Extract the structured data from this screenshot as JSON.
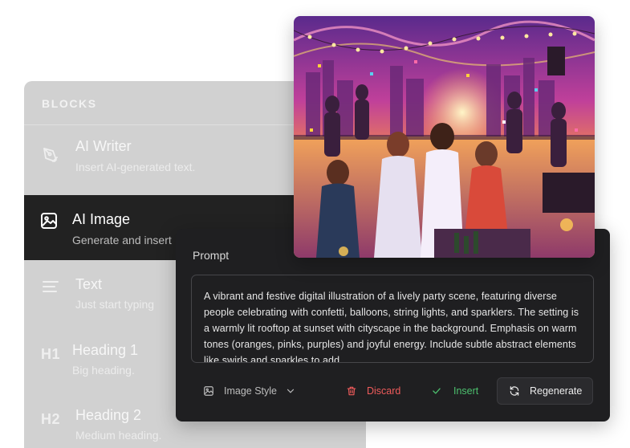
{
  "blocks": {
    "heading": "BLOCKS",
    "items": [
      {
        "title": "AI Writer",
        "desc": "Insert AI-generated text.",
        "icon": "pen-nib-icon"
      },
      {
        "title": "AI Image",
        "desc": "Generate and insert",
        "icon": "image-icon"
      },
      {
        "title": "Text",
        "desc": "Just start typing",
        "icon": "text-lines-icon"
      },
      {
        "title": "Heading 1",
        "desc": "Big heading.",
        "tag": "H1"
      },
      {
        "title": "Heading 2",
        "desc": "Medium heading.",
        "tag": "H2"
      }
    ]
  },
  "prompt": {
    "label": "Prompt",
    "text": "A vibrant and festive digital illustration of a lively party scene, featuring diverse people celebrating with confetti, balloons, string lights, and sparklers. The setting is a warmly lit rooftop at sunset with cityscape in the background. Emphasis on warm tones (oranges, pinks, purples) and joyful energy. Include subtle abstract elements like swirls and sparkles to add"
  },
  "toolbar": {
    "style_label": "Image Style",
    "discard_label": "Discard",
    "insert_label": "Insert",
    "regenerate_label": "Regenerate"
  },
  "colors": {
    "discard": "#ef5b5b",
    "insert": "#4cc06e",
    "panel_dark": "#1f1f21",
    "active_block": "#222222"
  }
}
